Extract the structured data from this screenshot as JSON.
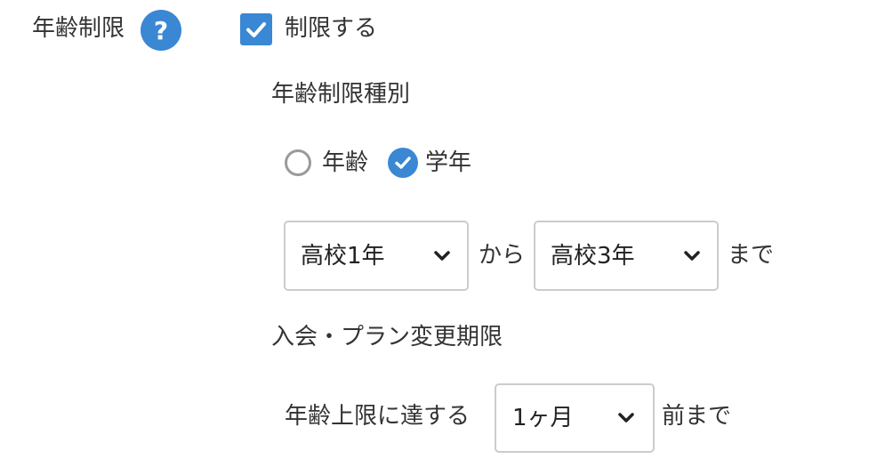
{
  "colors": {
    "accent": "#3a87d4",
    "text": "#333333",
    "border": "#cccccc",
    "radio_off": "#9a9a9a"
  },
  "age_restriction": {
    "label": "年齢制限",
    "help_icon": "question-icon",
    "help_glyph": "?",
    "restrict_checkbox": {
      "checked": true,
      "label": "制限する"
    }
  },
  "restriction_type": {
    "heading": "年齢制限種別",
    "options": [
      {
        "label": "年齢",
        "selected": false
      },
      {
        "label": "学年",
        "selected": true
      }
    ]
  },
  "grade_range": {
    "from_value": "高校1年",
    "from_suffix": "から",
    "to_value": "高校3年",
    "to_suffix": "まで"
  },
  "plan_change": {
    "heading": "入会・プラン変更期限",
    "prefix": "年齢上限に達する",
    "value": "1ヶ月",
    "suffix": "前まで"
  }
}
